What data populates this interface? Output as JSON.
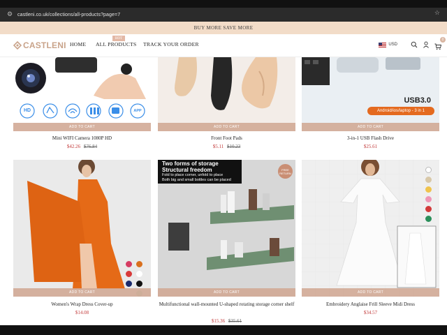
{
  "browser": {
    "url": "castleni.co.uk/collections/all-products?page=7",
    "tune_icon": "tune-icon",
    "star_icon": "star-icon"
  },
  "promo": {
    "text": "BUY MORE SAVE MORE"
  },
  "header": {
    "logo": "CASTLENI",
    "nav": [
      {
        "label": "HOME"
      },
      {
        "label": "ALL PRODUCTS",
        "badge": "HOT"
      },
      {
        "label": "TRACK YOUR ORDER"
      }
    ],
    "currency": "USD",
    "cart_count": "0",
    "icons": [
      "flag-icon",
      "search-icon",
      "account-icon",
      "cart-icon"
    ]
  },
  "products": [
    {
      "name": "Mini WIFI Camera 1080P HD",
      "price": "$42.26",
      "old_price": "$76.84",
      "add_label": "ADD TO CART",
      "features": [
        "HD",
        "",
        "",
        "",
        "",
        "APP"
      ]
    },
    {
      "name": "Front Foot Pads",
      "price": "$5.11",
      "old_price": "$10.23",
      "add_label": "ADD TO CART"
    },
    {
      "name": "3-in-1 USB Flash Drive",
      "price": "$25.61",
      "old_price": "",
      "add_label": "ADD TO CART",
      "overlay_title": "USB3.0",
      "overlay_pill": "Android/ios/laptop - 3 in 1"
    },
    {
      "name": "Women's Wrap Dress Cover-up",
      "price": "$14.08",
      "old_price": "",
      "add_label": "ADD TO CART",
      "swatches": [
        "#d63d63",
        "#d9701e",
        "#d83b3b",
        "#ffffff",
        "#1a2a6c",
        "#111111",
        "#9fd8b8"
      ]
    },
    {
      "name": "Multifunctional wall-mounted U-shaped rotating storage corner shelf",
      "price": "$15.36",
      "old_price": "$35.61",
      "add_label": "ADD TO CART",
      "banner_title_1": "Two forms of storage",
      "banner_title_2": "Structural freedom",
      "banner_line_1": "Fold to place corner, unfold to place",
      "banner_line_2": "Both big and small bottles can be placed",
      "seal_line_1": "FREE",
      "seal_line_2": "RETURN"
    },
    {
      "name": "Embroidery Anglaise Frill Sleeve Midi Dress",
      "price": "$34.57",
      "old_price": "",
      "add_label": "ADD TO CART",
      "swatches": [
        "#ffffff",
        "#d8c8a8",
        "#f0c34c",
        "#ef96b5",
        "#d23a3a",
        "#2a8f5a"
      ]
    }
  ]
}
